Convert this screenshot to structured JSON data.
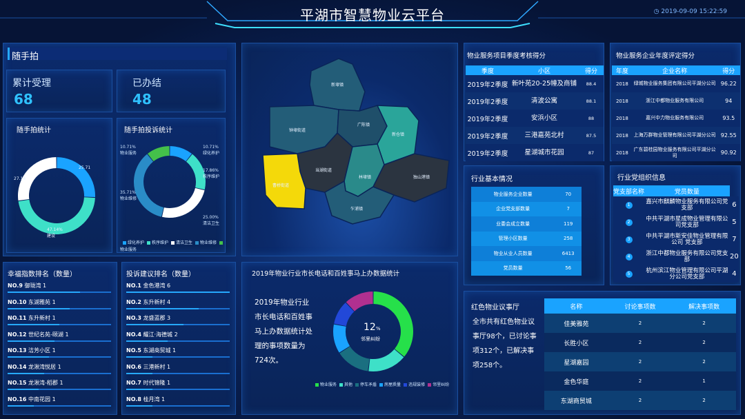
{
  "header": {
    "title": "平湖市智慧物业云平台",
    "time": "2019-09-09 15:22:59"
  },
  "snapshot": {
    "title": "随手拍",
    "accepted_label": "累计受理",
    "accepted_value": "68",
    "done_label": "已办结",
    "done_value": "48"
  },
  "stats_chart": {
    "title": "随手拍统计",
    "slices": [
      {
        "label": "25.71",
        "value": 25.71,
        "color": "#1aa3ff"
      },
      {
        "label": "47.14",
        "value": 47.14,
        "color": "#3ee0c8"
      },
      {
        "label": "27.14",
        "value": 27.14,
        "color": "#ffffff"
      }
    ],
    "left_label": "27.14",
    "bottom_label_a": "47.14%",
    "bottom_label_b": "建设"
  },
  "complaint_chart": {
    "title": "随手拍投诉统计",
    "slices": [
      {
        "name": "绿化养护",
        "value": 10.71,
        "color": "#1aa3ff"
      },
      {
        "name": "秩序维护",
        "value": 17.86,
        "color": "#3ee0c8"
      },
      {
        "name": "清洁卫生",
        "value": 25.0,
        "color": "#ffffff"
      },
      {
        "name": "物业维修",
        "value": 35.71,
        "color": "#2a8cc7"
      },
      {
        "name": "物业服务",
        "value": 10.71,
        "color": "#44c04a"
      }
    ],
    "labels": {
      "tl_pct": "10.71%",
      "tl_name": "物业服务",
      "tr_pct": "10.71%",
      "tr_name": "绿化养护",
      "r_pct": "17.86%",
      "r_name": "秩序维护",
      "l_pct": "35.71%",
      "l_name": "物业维修",
      "br_pct": "25.00%",
      "br_name": "清洁卫生"
    },
    "legend": [
      "绿化养护",
      "秩序维护",
      "清洁卫生",
      "物业维修",
      "物业服务"
    ]
  },
  "map": {
    "regions": [
      "新埭镇",
      "钟埭街道",
      "广陈镇",
      "新仓镇",
      "当湖街道",
      "曹桥街道",
      "林埭镇",
      "独山港镇",
      "乍浦镇"
    ]
  },
  "happiness_rank": {
    "title": "幸福指数排名（数量）",
    "items": [
      {
        "no": "NO.9",
        "name": "御珑湾 1",
        "pct": 0.7
      },
      {
        "no": "NO.10",
        "name": "东湖雅苑 1",
        "pct": 0.6
      },
      {
        "no": "NO.11",
        "name": "东升新村 1",
        "pct": 0.5
      },
      {
        "no": "NO.12",
        "name": "世纪名苑-颐湖 1",
        "pct": 0.45
      },
      {
        "no": "NO.13",
        "name": "洁芳小区 1",
        "pct": 0.4
      },
      {
        "no": "NO.14",
        "name": "龙湫湾悦居 1",
        "pct": 0.35
      },
      {
        "no": "NO.15",
        "name": "龙湫湾-稻郡 1",
        "pct": 0.3
      },
      {
        "no": "NO.16",
        "name": "中南花园 1",
        "pct": 0.25
      }
    ]
  },
  "complaint_rank": {
    "title": "投诉建议排名（数量）",
    "items": [
      {
        "no": "NO.1",
        "name": "金色港湾 6",
        "pct": 1.0
      },
      {
        "no": "NO.2",
        "name": "东升新村 4",
        "pct": 0.7
      },
      {
        "no": "NO.3",
        "name": "龙盛蓝郡 3",
        "pct": 0.55
      },
      {
        "no": "NO.4",
        "name": "耀江·海德城 2",
        "pct": 0.4
      },
      {
        "no": "NO.5",
        "name": "东湖商贸城 1",
        "pct": 0.25
      },
      {
        "no": "NO.6",
        "name": "三港新村 1",
        "pct": 0.25
      },
      {
        "no": "NO.7",
        "name": "时代锦隆 1",
        "pct": 0.25
      },
      {
        "no": "NO.8",
        "name": "桂月湾 1",
        "pct": 0.25
      }
    ]
  },
  "hotline": {
    "title": "2019年物业行业市长电话和百姓事马上办数据统计",
    "text": "2019年物业行业市长电话和百姓事马上办数据统计处理的事项数量为724次。",
    "center_value": "12",
    "center_unit": "%",
    "center_label": "邻里纠纷",
    "slices": [
      {
        "name": "物业服务",
        "value": 36,
        "color": "#26e04a"
      },
      {
        "name": "其他",
        "value": 16,
        "color": "#3ee0c8"
      },
      {
        "name": "停车矛盾",
        "value": 14,
        "color": "#1a6f80"
      },
      {
        "name": "房屋质量",
        "value": 12,
        "color": "#1aa3ff"
      },
      {
        "name": "违规装修",
        "value": 10,
        "color": "#2248d8"
      },
      {
        "name": "邻里纠纷",
        "value": 12,
        "color": "#b03090"
      }
    ]
  },
  "quarter_scores": {
    "title": "物业服务项目季度考核得分",
    "headers": [
      "季度",
      "小区",
      "得分"
    ],
    "rows": [
      [
        "2019年2季度",
        "新叶苑20-25幢及商铺",
        "88.4"
      ],
      [
        "2019年2季度",
        "清波公寓",
        "88.1"
      ],
      [
        "2019年2季度",
        "安浜小区",
        "88"
      ],
      [
        "2019年2季度",
        "三港嘉苑北村",
        "87.5"
      ],
      [
        "2019年2季度",
        "星湖城市花园",
        "87"
      ]
    ]
  },
  "annual_scores": {
    "title": "物业服务企业年度评定得分",
    "headers": [
      "年度",
      "企业名称",
      "得分"
    ],
    "rows": [
      [
        "2018",
        "绿城物业服务集团有限公司平湖分公司",
        "96.22"
      ],
      [
        "2018",
        "浙江中都物业服务有限公司",
        "94"
      ],
      [
        "2018",
        "嘉兴中力物业服务有限公司",
        "93.5"
      ],
      [
        "2018",
        "上海万群物业管理有限公司平湖分公司",
        "92.55"
      ],
      [
        "2018",
        "广东碧桂园物业服务有限公司平湖分公司",
        "90.92"
      ]
    ]
  },
  "industry": {
    "title": "行业基本情况",
    "rows": [
      [
        "物业服务企业数量",
        "70"
      ],
      [
        "企业党支部数量",
        "7"
      ],
      [
        "业委会成立数量",
        "119"
      ],
      [
        "管理小区数量",
        "258"
      ],
      [
        "物业从业人员数量",
        "6413"
      ],
      [
        "党员数量",
        "56"
      ]
    ]
  },
  "party": {
    "title": "行业党组织信息",
    "headers": [
      "党支部名称",
      "党员数量"
    ],
    "rows": [
      [
        "1",
        "嘉兴市麒麟物业服务有限公司党支部",
        "6"
      ],
      [
        "2",
        "中共平湖市星成物业管理有限公司党支部",
        "5"
      ],
      [
        "3",
        "中共平湖市新安佳物业管理有限公司 党支部",
        "7"
      ],
      [
        "4",
        "浙江中都物业服务有限公司党支部",
        "20"
      ],
      [
        "5",
        "杭州滨江物业管理有限公司平湖分公司党支部",
        "4"
      ]
    ]
  },
  "red_hall": {
    "title": "红色物业议事厅",
    "text": "全市共有红色物业议事厅98个，已讨论事项312个，已解决事项258个。",
    "headers": [
      "名称",
      "讨论事项数",
      "解决事项数"
    ],
    "rows": [
      [
        "佳美雅苑",
        "2",
        "2"
      ],
      [
        "长胜小区",
        "2",
        "2"
      ],
      [
        "星湖嘉园",
        "2",
        "2"
      ],
      [
        "金色华庭",
        "2",
        "1"
      ],
      [
        "东湖商贸城",
        "2",
        "2"
      ]
    ]
  }
}
